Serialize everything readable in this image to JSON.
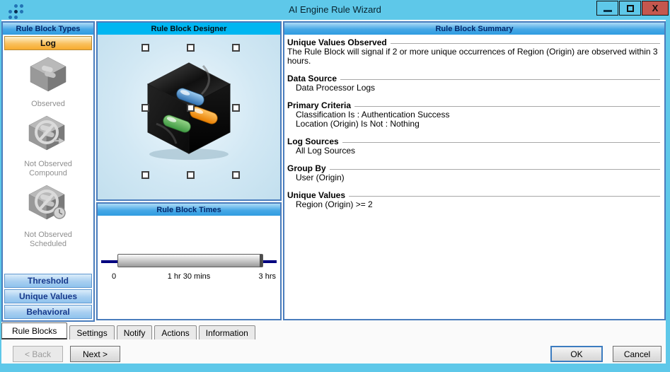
{
  "window": {
    "title": "AI Engine Rule Wizard",
    "close_glyph": "X"
  },
  "colors": {
    "titlebar": "#5EC8E9",
    "close_button": "#C4574E",
    "panel_border": "#4A7DBD",
    "group_header_top": "#AEDCF7",
    "group_header_bottom": "#2F9CE0",
    "designer_header": "#00B6F1",
    "log_button_orange": "#F7AB2E",
    "type_button_blue": "#8FC3ED",
    "pill_blue": "#3A7FC1",
    "pill_orange": "#EF8A00",
    "pill_green": "#46A049",
    "slider_track": "#00007F"
  },
  "rule_block_types": {
    "header": "Rule Block Types",
    "selected": "Log",
    "items": [
      {
        "label": "Observed"
      },
      {
        "label": "Not Observed Compound"
      },
      {
        "label": "Not Observed Scheduled"
      }
    ],
    "other_types": [
      "Threshold",
      "Unique Values",
      "Behavioral"
    ]
  },
  "designer": {
    "header": "Rule Block Designer"
  },
  "times": {
    "header": "Rule Block Times",
    "tick_start": "0",
    "tick_mid": "1 hr 30 mins",
    "tick_end": "3 hrs"
  },
  "summary": {
    "header": "Rule Block Summary",
    "sections": [
      {
        "title": "Unique Values Observed",
        "line1": "The Rule Block will signal if 2 or more unique occurrences of Region (Origin) are observed within 3 hours."
      },
      {
        "title": "Data Source",
        "line1": "Data Processor Logs"
      },
      {
        "title": "Primary Criteria",
        "line1": "Classification Is : Authentication Success",
        "line2": "Location (Origin) Is Not : Nothing"
      },
      {
        "title": "Log Sources",
        "line1": "All Log Sources"
      },
      {
        "title": "Group By",
        "line1": "User (Origin)"
      },
      {
        "title": "Unique Values",
        "line1": "Region (Origin) >= 2"
      }
    ]
  },
  "tabs": [
    {
      "label": "Rule Blocks"
    },
    {
      "label": "Settings"
    },
    {
      "label": "Notify"
    },
    {
      "label": "Actions"
    },
    {
      "label": "Information"
    }
  ],
  "nav": {
    "back": "< Back",
    "next": "Next >",
    "ok": "OK",
    "cancel": "Cancel"
  }
}
